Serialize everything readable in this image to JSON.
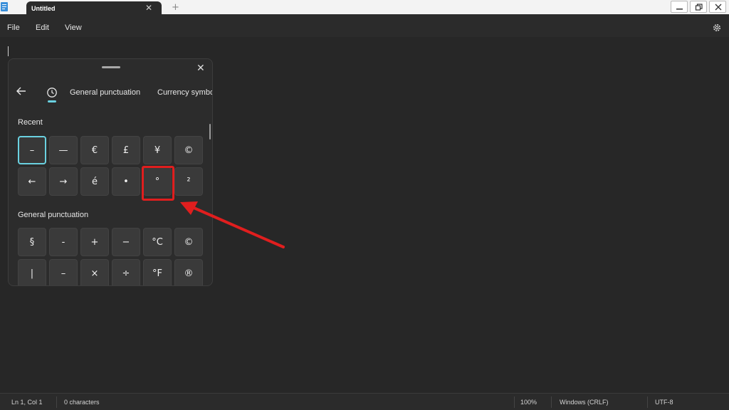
{
  "window": {
    "tab_title": "Untitled",
    "tab_close": "✕",
    "new_tab": "+"
  },
  "menu": {
    "file": "File",
    "edit": "Edit",
    "view": "View"
  },
  "emoji_panel": {
    "close": "✕",
    "tabs": [
      "General punctuation",
      "Currency symbo"
    ],
    "recent_title": "Recent",
    "recent": [
      "–",
      "—",
      "€",
      "£",
      "¥",
      "©",
      "←",
      "→",
      "é",
      "•",
      "°",
      "²"
    ],
    "punctuation_title": "General punctuation",
    "punctuation": [
      "§",
      "-",
      "+",
      "−",
      "°C",
      "©",
      "|",
      "–",
      "×",
      "÷",
      "°F",
      "®"
    ]
  },
  "status": {
    "position": "Ln 1, Col 1",
    "characters": "0 characters",
    "zoom": "100%",
    "line_ending": "Windows (CRLF)",
    "encoding": "UTF-8"
  },
  "colors": {
    "accent": "#6ad1e0",
    "annotation": "#e01e1e",
    "background": "#272727"
  }
}
